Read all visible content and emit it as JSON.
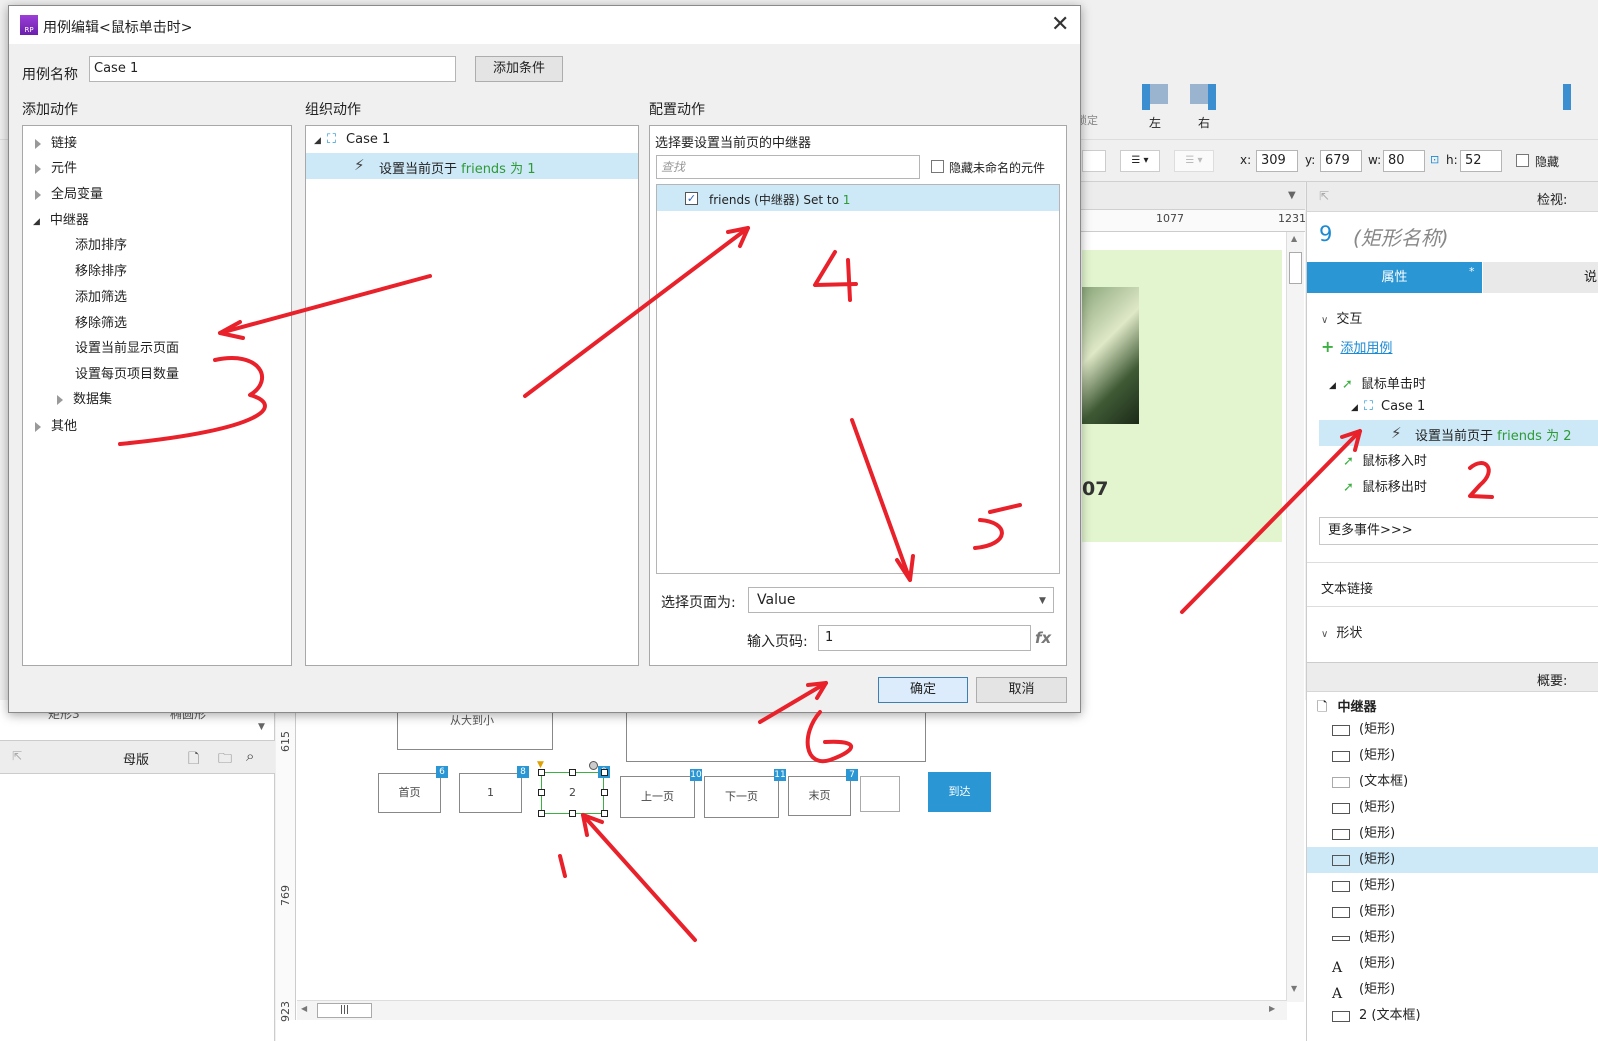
{
  "dialog": {
    "title": "用例编辑<鼠标单击时>",
    "case_name_label": "用例名称",
    "case_name_value": "Case 1",
    "add_condition": "添加条件",
    "ok": "确定",
    "cancel": "取消"
  },
  "add_actions": {
    "heading": "添加动作",
    "items": [
      {
        "label": "链接",
        "expanded": false
      },
      {
        "label": "元件",
        "expanded": false
      },
      {
        "label": "全局变量",
        "expanded": false
      },
      {
        "label": "中继器",
        "expanded": true,
        "children": [
          "添加排序",
          "移除排序",
          "添加筛选",
          "移除筛选",
          "设置当前显示页面",
          "设置每页项目数量",
          "数据集"
        ]
      },
      {
        "label": "其他",
        "expanded": false
      }
    ]
  },
  "organize_actions": {
    "heading": "组织动作",
    "case_label": "Case 1",
    "action_prefix": "设置当前页于",
    "action_target": "friends 为 1"
  },
  "configure_actions": {
    "heading": "配置动作",
    "subheading": "选择要设置当前页的中继器",
    "search_placeholder": "查找",
    "hide_unnamed": "隐藏未命名的元件",
    "repeater_item_label": "friends (中继器) Set to",
    "repeater_item_value": "1",
    "select_page_label": "选择页面为:",
    "select_page_value": "Value",
    "page_input_label": "输入页码:",
    "page_input_value": "1",
    "fx": "fx"
  },
  "toolbar": {
    "lock_label": "锁定",
    "left_label": "左",
    "right_label": "右",
    "x_label": "x:",
    "x_value": "309",
    "y_label": "y:",
    "y_value": "679",
    "w_label": "w:",
    "w_value": "80",
    "h_label": "h:",
    "h_value": "52",
    "hide_label": "隐藏"
  },
  "ruler": {
    "t1": "1077",
    "t2": "1231",
    "l1": "615",
    "l2": "769",
    "l3": "923"
  },
  "canvas": {
    "text_07": "07",
    "paging": [
      "首页",
      "1",
      "2",
      "上一页",
      "下一页",
      "末页",
      "",
      "到达"
    ],
    "badges": [
      "6",
      "8",
      "9",
      "10",
      "11",
      "7"
    ],
    "box_top_label": "从大到小"
  },
  "left_panel": {
    "row_labels": [
      "矩形3",
      "椭圆形"
    ],
    "masters_label": "母版"
  },
  "right_panel": {
    "inspect_label": "检视:",
    "widget_number": "9",
    "widget_name": "(矩形名称)",
    "tab_properties": "属性",
    "tab_notes": "说",
    "interaction": "交互",
    "add_case": "添加用例",
    "event_click": "鼠标单击时",
    "case_label": "Case 1",
    "action_prefix": "设置当前页于",
    "action_target": "friends 为 2",
    "event_enter": "鼠标移入时",
    "event_leave": "鼠标移出时",
    "more_events": "更多事件>>>",
    "text_link": "文本链接",
    "shape": "形状",
    "outline_label": "概要:",
    "outline_root": "中继器",
    "outline_items": [
      "(矩形)",
      "(矩形)",
      "(文本框)",
      "(矩形)",
      "(矩形)",
      "(矩形)",
      "(矩形)",
      "(矩形)",
      "(矩形)",
      "(矩形)",
      "(矩形)",
      "2 (文本框)"
    ]
  },
  "annotations": [
    "1",
    "2",
    "3",
    "4",
    "5",
    "6"
  ],
  "colors": {
    "accent": "#2a96d4",
    "green": "#2e9a35",
    "annotation": "#e8212a",
    "selection": "#cde8f7"
  }
}
